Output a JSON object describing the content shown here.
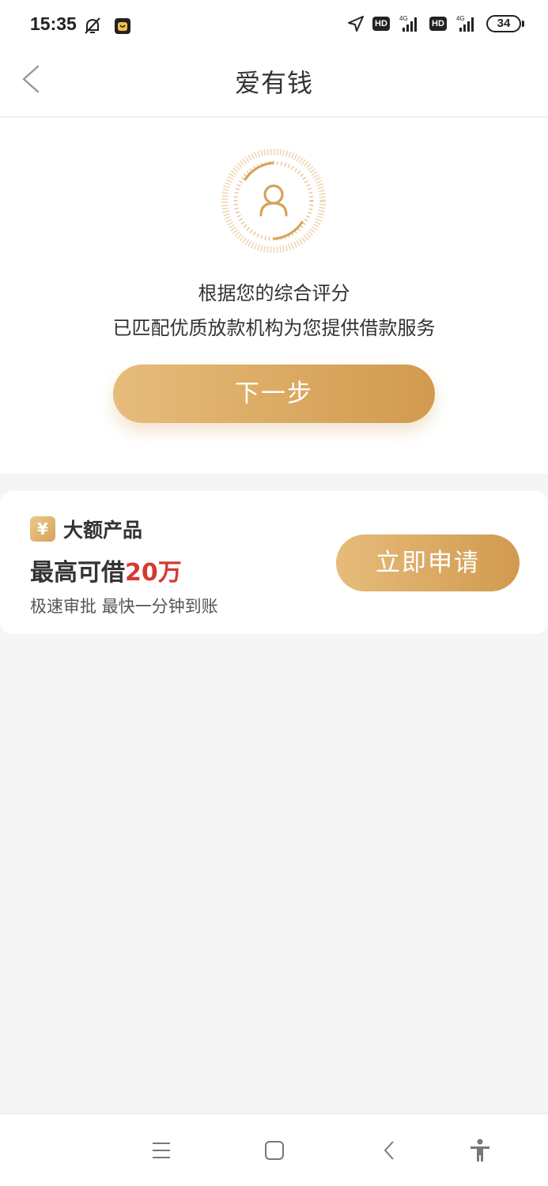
{
  "status_bar": {
    "time": "15:35",
    "hd1": "HD",
    "net1": "4G",
    "hd2": "HD",
    "net2": "4G",
    "battery": "34"
  },
  "header": {
    "title": "爱有钱"
  },
  "hero": {
    "line1": "根据您的综合评分",
    "line2": "已匹配优质放款机构为您提供借款服务",
    "next_button": "下一步"
  },
  "product": {
    "tag_icon": "¥",
    "name": "大额产品",
    "amount_prefix": "最高可借",
    "amount_value": "20万",
    "description": "极速审批 最快一分钟到账",
    "apply_button": "立即申请"
  },
  "colors": {
    "gold_start": "#e6bc7b",
    "gold_end": "#d19a4f",
    "amount_red": "#d43a31"
  }
}
